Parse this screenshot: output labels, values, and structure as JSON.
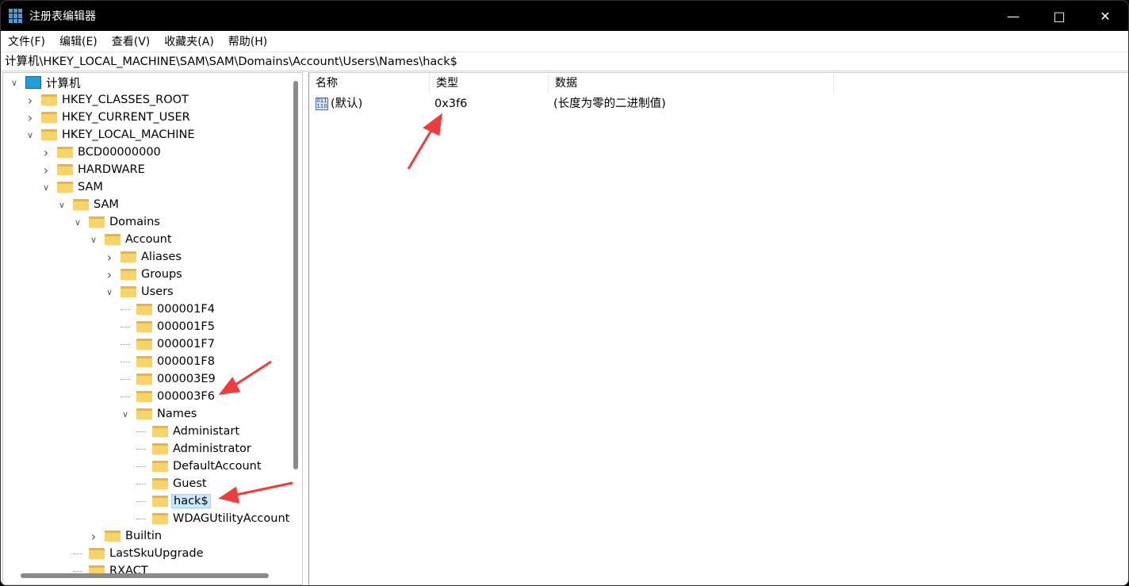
{
  "window": {
    "title": "注册表编辑器",
    "controls": [
      "minimize",
      "maximize",
      "close"
    ]
  },
  "menu": [
    "文件(F)",
    "编辑(E)",
    "查看(V)",
    "收藏夹(A)",
    "帮助(H)"
  ],
  "address": "计算机\\HKEY_LOCAL_MACHINE\\SAM\\SAM\\Domains\\Account\\Users\\Names\\hack$",
  "tree": [
    {
      "label": "计算机",
      "level": 0,
      "exp": "open",
      "icon": "computer"
    },
    {
      "label": "HKEY_CLASSES_ROOT",
      "level": 1,
      "exp": "closed"
    },
    {
      "label": "HKEY_CURRENT_USER",
      "level": 1,
      "exp": "closed"
    },
    {
      "label": "HKEY_LOCAL_MACHINE",
      "level": 1,
      "exp": "open"
    },
    {
      "label": "BCD00000000",
      "level": 2,
      "exp": "closed"
    },
    {
      "label": "HARDWARE",
      "level": 2,
      "exp": "closed"
    },
    {
      "label": "SAM",
      "level": 2,
      "exp": "open"
    },
    {
      "label": "SAM",
      "level": 3,
      "exp": "open"
    },
    {
      "label": "Domains",
      "level": 4,
      "exp": "open"
    },
    {
      "label": "Account",
      "level": 5,
      "exp": "open"
    },
    {
      "label": "Aliases",
      "level": 6,
      "exp": "closed"
    },
    {
      "label": "Groups",
      "level": 6,
      "exp": "closed"
    },
    {
      "label": "Users",
      "level": 6,
      "exp": "open"
    },
    {
      "label": "000001F4",
      "level": 7,
      "exp": "none"
    },
    {
      "label": "000001F5",
      "level": 7,
      "exp": "none"
    },
    {
      "label": "000001F7",
      "level": 7,
      "exp": "none"
    },
    {
      "label": "000001F8",
      "level": 7,
      "exp": "none"
    },
    {
      "label": "000003E9",
      "level": 7,
      "exp": "none"
    },
    {
      "label": "000003F6",
      "level": 7,
      "exp": "none"
    },
    {
      "label": "Names",
      "level": 7,
      "exp": "open"
    },
    {
      "label": "Administart",
      "level": 8,
      "exp": "none"
    },
    {
      "label": "Administrator",
      "level": 8,
      "exp": "none"
    },
    {
      "label": "DefaultAccount",
      "level": 8,
      "exp": "none"
    },
    {
      "label": "Guest",
      "level": 8,
      "exp": "none"
    },
    {
      "label": "hack$",
      "level": 8,
      "exp": "none",
      "selected": true
    },
    {
      "label": "WDAGUtilityAccount",
      "level": 8,
      "exp": "none"
    },
    {
      "label": "Builtin",
      "level": 5,
      "exp": "closed"
    },
    {
      "label": "LastSkuUpgrade",
      "level": 4,
      "exp": "none"
    },
    {
      "label": "RXACT",
      "level": 4,
      "exp": "none"
    }
  ],
  "columns": [
    "名称",
    "类型",
    "数据"
  ],
  "values": [
    {
      "name": "(默认)",
      "type": "0x3f6",
      "data": "(长度为零的二进制值)",
      "icon": "binary-value-icon"
    }
  ],
  "annotation_color": "#f03c3c"
}
